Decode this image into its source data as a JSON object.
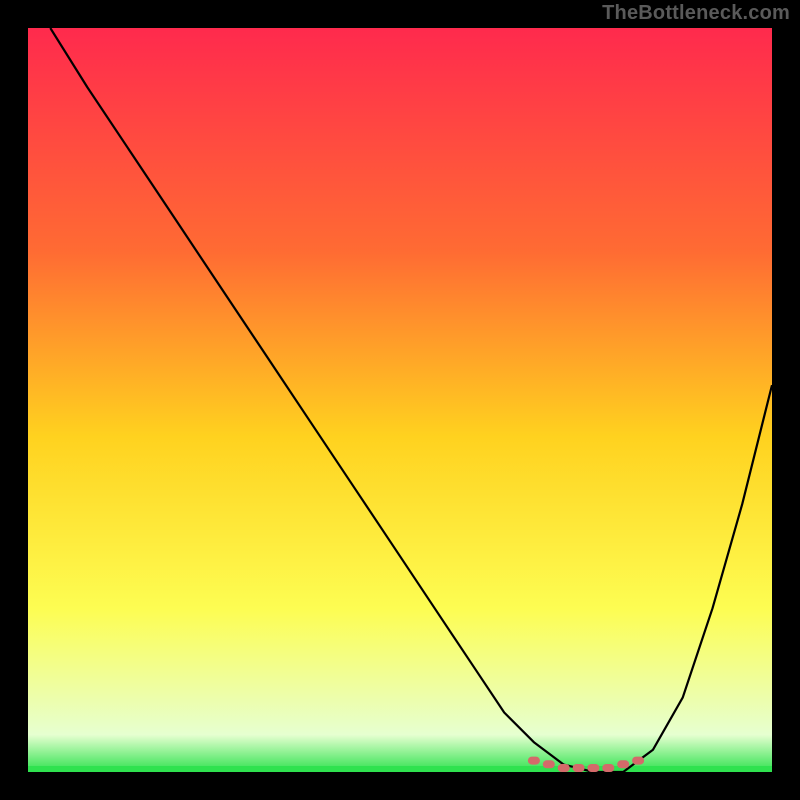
{
  "watermark": "TheBottleneck.com",
  "colors": {
    "frame_bg": "#000000",
    "gradient_top": "#ff2a4d",
    "gradient_mid1": "#ff6b33",
    "gradient_mid2": "#ffd21f",
    "gradient_mid3": "#fdfd52",
    "gradient_bottom": "#e6ffd0",
    "baseline_green": "#2fe24f",
    "curve": "#000000",
    "marker": "#d46a6a"
  },
  "chart_data": {
    "type": "line",
    "title": "",
    "xlabel": "",
    "ylabel": "",
    "xlim": [
      0,
      100
    ],
    "ylim": [
      0,
      100
    ],
    "series": [
      {
        "name": "bottleneck-curve",
        "x": [
          3,
          8,
          14,
          20,
          26,
          32,
          38,
          44,
          50,
          56,
          60,
          64,
          68,
          72,
          76,
          80,
          84,
          88,
          92,
          96,
          100
        ],
        "y": [
          100,
          92,
          83,
          74,
          65,
          56,
          47,
          38,
          29,
          20,
          14,
          8,
          4,
          1,
          0,
          0,
          3,
          10,
          22,
          36,
          52
        ]
      }
    ],
    "markers": {
      "name": "optimal-range",
      "x": [
        68,
        70,
        72,
        74,
        76,
        78,
        80,
        82
      ],
      "y": [
        1,
        0.5,
        0,
        0,
        0,
        0,
        0.5,
        1
      ]
    }
  }
}
